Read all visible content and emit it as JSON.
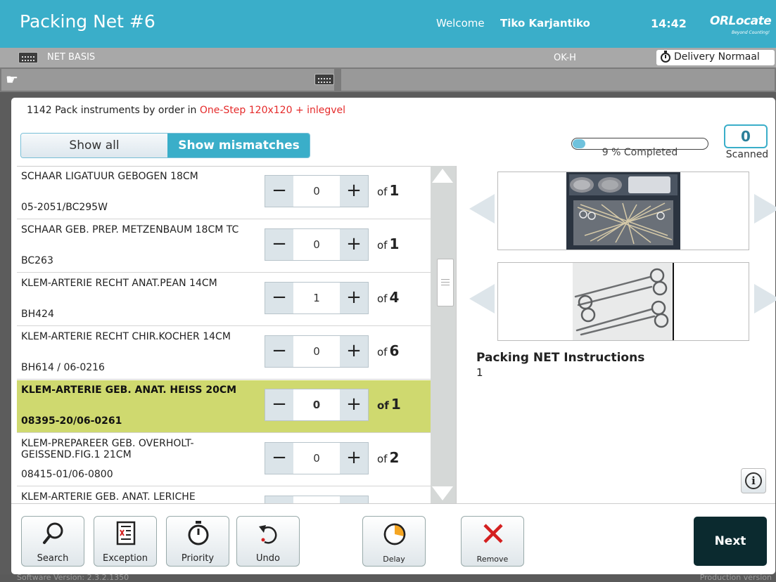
{
  "header": {
    "title": "Packing Net #6",
    "welcome_label": "Welcome",
    "user_name": "Tiko Karjantiko",
    "time": "14:42",
    "logo": "ORLocate",
    "logo_tagline": "Beyond Counting!"
  },
  "subheader": {
    "net_basis": "NET BASIS",
    "location": "OK-H",
    "delivery": "Delivery Normaal"
  },
  "panel": {
    "title_prefix": "1142 Pack instruments by order in ",
    "title_set": "One-Step 120x120 + inlegvel",
    "toggle": {
      "show_all": "Show all",
      "show_mismatches": "Show mismatches",
      "active": "show_mismatches"
    },
    "progress": {
      "percent": 9,
      "label": "9 % Completed"
    },
    "scanned": {
      "count": "0",
      "label": "Scanned"
    }
  },
  "items": [
    {
      "name": "SCHAAR LIGATUUR GEBOGEN 18CM",
      "code": "05-2051/BC295W",
      "count": "0",
      "of_label": "of",
      "total": "1",
      "selected": false
    },
    {
      "name": "SCHAAR GEB. PREP. METZENBAUM 18CM TC",
      "code": "BC263",
      "count": "0",
      "of_label": "of",
      "total": "1",
      "selected": false
    },
    {
      "name": "KLEM-ARTERIE RECHT ANAT.PEAN 14CM",
      "code": "BH424",
      "count": "1",
      "of_label": "of",
      "total": "4",
      "selected": false
    },
    {
      "name": "KLEM-ARTERIE RECHT CHIR.KOCHER 14CM",
      "code": "BH614 / 06-0216",
      "count": "0",
      "of_label": "of",
      "total": "6",
      "selected": false
    },
    {
      "name": "KLEM-ARTERIE GEB. ANAT. HEISS 20CM",
      "code": "08395-20/06-0261",
      "count": "0",
      "of_label": "of",
      "total": "1",
      "selected": true
    },
    {
      "name": "KLEM-PREPAREER GEB. OVERHOLT-GEISSEND.FIG.1 21CM",
      "code": "08415-01/06-0800",
      "count": "0",
      "of_label": "of",
      "total": "2",
      "selected": false
    },
    {
      "name": "KLEM-ARTERIE GEB. ANAT. LERICHE",
      "code": "",
      "count": "",
      "of_label": "",
      "total": "",
      "selected": false
    }
  ],
  "instructions": {
    "title": "Packing NET Instructions",
    "value": "1"
  },
  "toolbar": {
    "search": "Search",
    "exception": "Exception",
    "priority": "Priority",
    "undo": "Undo",
    "delay": "Delay",
    "remove": "Remove",
    "next": "Next"
  },
  "status": {
    "version": "Software Version: 2.3.2.1350",
    "mode": "Production version"
  },
  "colors": {
    "accent": "#3aaec9",
    "selected_row": "#cfd96f",
    "highlight_text": "#e52b2b",
    "next_button": "#0b2a2f",
    "remove_icon": "#d42020",
    "delay_icon": "#f5a623"
  }
}
